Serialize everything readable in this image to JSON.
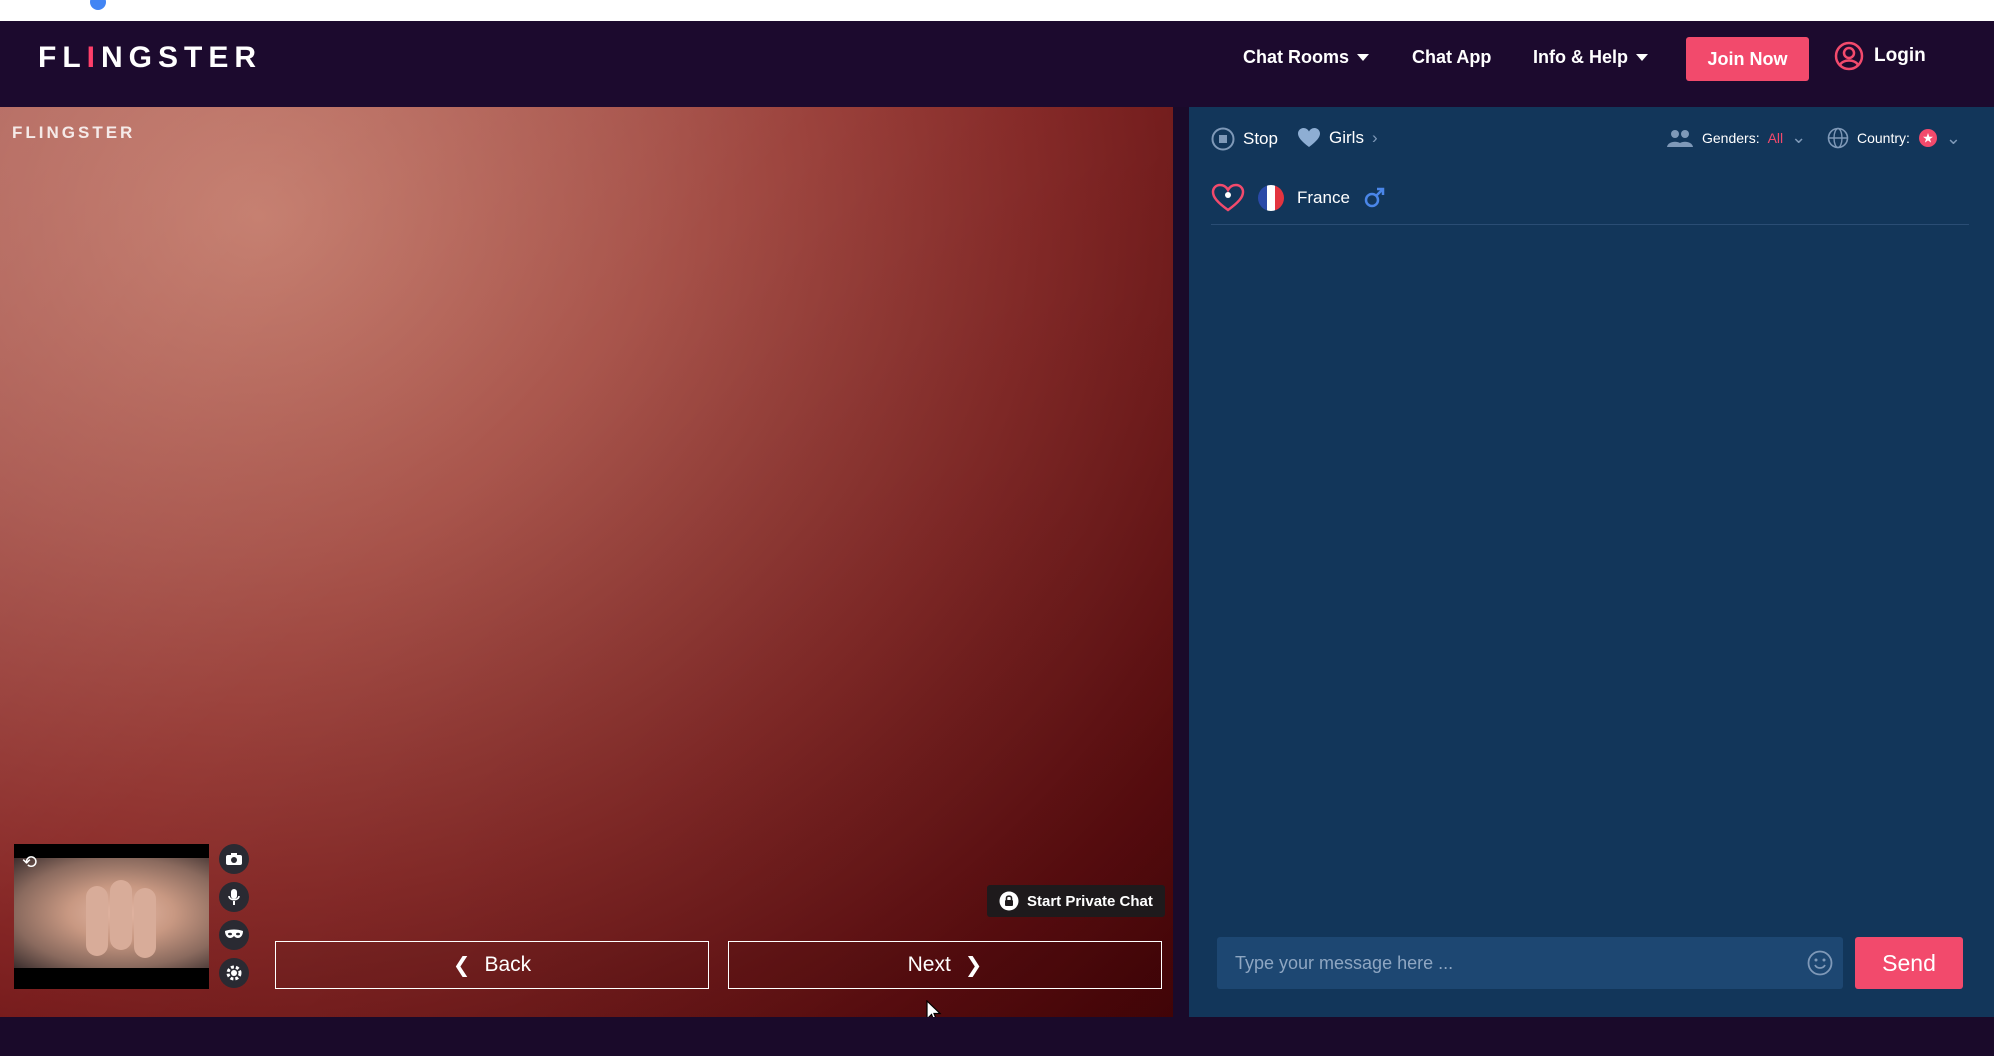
{
  "brand": {
    "logo_text_a": "FL",
    "logo_text_i": "I",
    "logo_text_b": "NGSTER",
    "watermark": "FLINGSTER",
    "accent": "#f24a6c"
  },
  "nav": {
    "chat_rooms": "Chat Rooms",
    "chat_app": "Chat App",
    "info_help": "Info & Help",
    "join": "Join Now",
    "login": "Login"
  },
  "video": {
    "start_private": "Start Private Chat",
    "back": "Back",
    "next": "Next",
    "controls": [
      "camera-icon",
      "microphone-icon",
      "mask-icon",
      "settings-icon"
    ]
  },
  "panel": {
    "stop": "Stop",
    "girls": "Girls",
    "genders_label": "Genders:",
    "genders_value": "All",
    "country_label": "Country:",
    "partner_country": "France",
    "message_placeholder": "Type your message here ...",
    "send": "Send"
  }
}
